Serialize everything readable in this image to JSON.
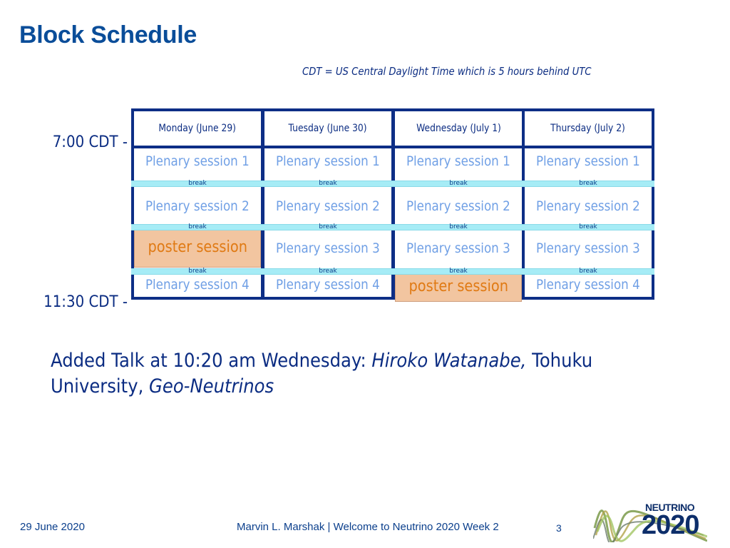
{
  "slide": {
    "title": "Block Schedule",
    "note": "CDT = US Central Daylight Time which is 5 hours behind UTC",
    "time_start": "7:00 CDT -",
    "time_end": "11:30 CDT -"
  },
  "schedule": {
    "break_label": "break",
    "days": [
      {
        "header": "Monday (June 29)",
        "slots": [
          "Plenary session 1",
          "Plenary session 2",
          "poster session",
          "Plenary session 4"
        ],
        "poster_index": 2
      },
      {
        "header": "Tuesday (June 30)",
        "slots": [
          "Plenary session 1",
          "Plenary session 2",
          "Plenary session 3",
          "Plenary session 4"
        ],
        "poster_index": -1
      },
      {
        "header": "Wednesday (July 1)",
        "slots": [
          "Plenary session 1",
          "Plenary session 2",
          "Plenary session 3",
          "poster session"
        ],
        "poster_index": 3
      },
      {
        "header": "Thursday (July 2)",
        "slots": [
          "Plenary session 1",
          "Plenary session 2",
          "Plenary session 3",
          "Plenary session 4"
        ],
        "poster_index": -1
      }
    ]
  },
  "announcement": {
    "prefix": "Added Talk at 10:20 am Wednesday: ",
    "speaker": "Hiroko Watanabe,",
    "affiliation": " Tohuku University, ",
    "topic": "Geo-Neutrinos"
  },
  "footer": {
    "date": "29 June 2020",
    "presenter": "Marvin L. Marshak |  Welcome to Neutrino 2020 Week 2",
    "page_number": "3",
    "logo_word": "NEUTRINO",
    "logo_year": "2020"
  },
  "colors": {
    "title": "#0a4d99",
    "grid_border": "#0d2e86",
    "plenary_text": "#6f9fe5",
    "poster_bg": "#f2c5a0",
    "poster_text": "#e07a14",
    "break_bar": "#a6ecf6"
  }
}
